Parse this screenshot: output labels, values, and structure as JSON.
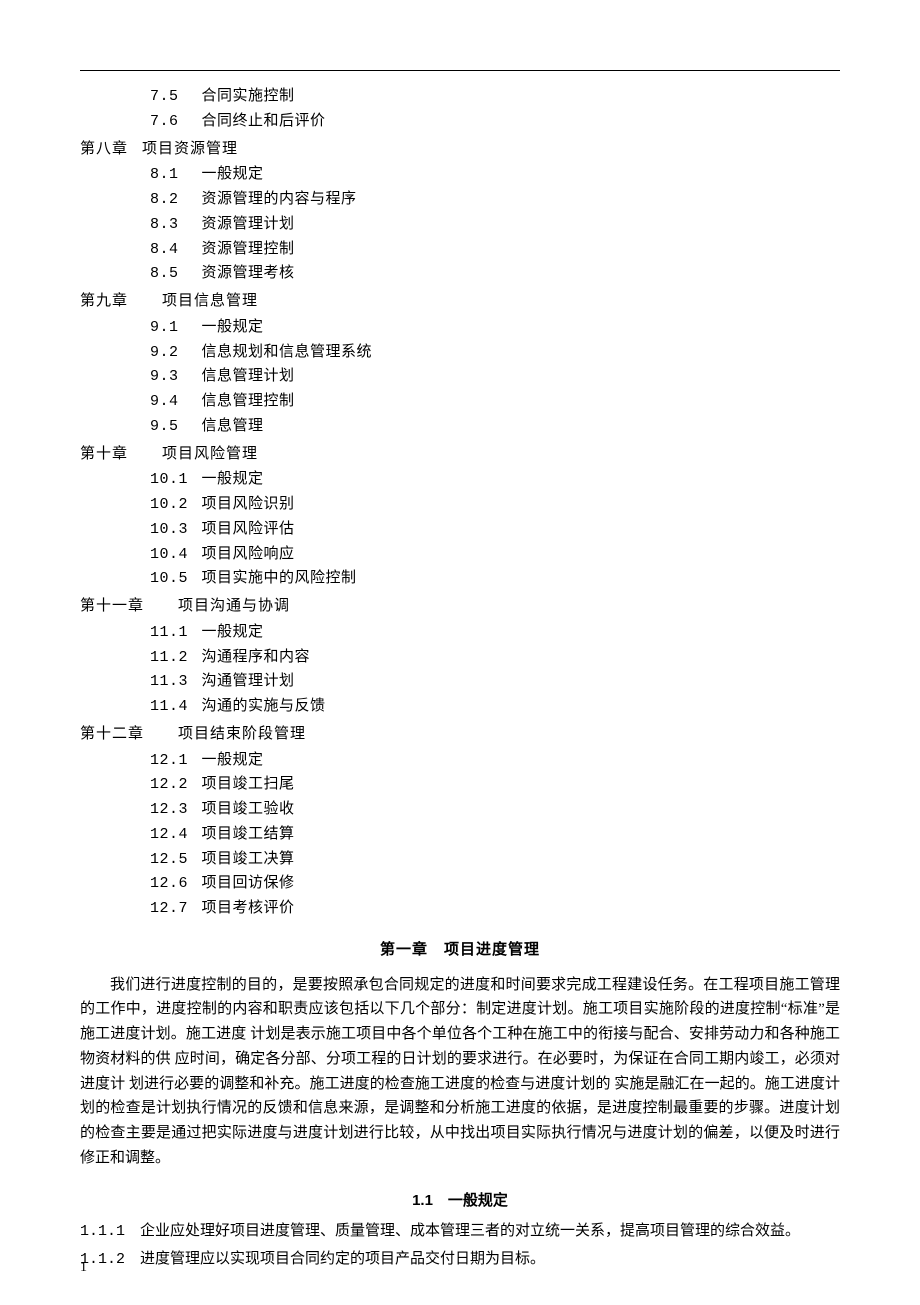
{
  "toc": {
    "pre": [
      {
        "num": "7.5",
        "title": "合同实施控制"
      },
      {
        "num": "7.6",
        "title": "合同终止和后评价"
      }
    ],
    "chapters": [
      {
        "heading": "第八章",
        "title": "项目资源管理",
        "gap": "s",
        "items": [
          {
            "num": "8.1",
            "title": "一般规定"
          },
          {
            "num": "8.2",
            "title": "资源管理的内容与程序"
          },
          {
            "num": "8.3",
            "title": "资源管理计划"
          },
          {
            "num": "8.4",
            "title": "资源管理控制"
          },
          {
            "num": "8.5",
            "title": "资源管理考核"
          }
        ]
      },
      {
        "heading": "第九章",
        "title": "项目信息管理",
        "gap": "m",
        "items": [
          {
            "num": "9.1",
            "title": "一般规定"
          },
          {
            "num": "9.2",
            "title": "信息规划和信息管理系统"
          },
          {
            "num": "9.3",
            "title": "信息管理计划"
          },
          {
            "num": "9.4",
            "title": "信息管理控制"
          },
          {
            "num": "9.5",
            "title": "信息管理"
          }
        ]
      },
      {
        "heading": "第十章",
        "title": "项目风险管理",
        "gap": "m",
        "items": [
          {
            "num": "10.1",
            "title": "一般规定"
          },
          {
            "num": "10.2",
            "title": "项目风险识别"
          },
          {
            "num": "10.3",
            "title": "项目风险评估"
          },
          {
            "num": "10.4",
            "title": "项目风险响应"
          },
          {
            "num": "10.5",
            "title": "项目实施中的风险控制"
          }
        ]
      },
      {
        "heading": "第十一章",
        "title": "项目沟通与协调",
        "gap": "m",
        "items": [
          {
            "num": "11.1",
            "title": "一般规定"
          },
          {
            "num": "11.2",
            "title": "沟通程序和内容"
          },
          {
            "num": "11.3",
            "title": "沟通管理计划"
          },
          {
            "num": "11.4",
            "title": "沟通的实施与反馈"
          }
        ]
      },
      {
        "heading": "第十二章",
        "title": "项目结束阶段管理",
        "gap": "m",
        "items": [
          {
            "num": "12.1",
            "title": "一般规定"
          },
          {
            "num": "12.2",
            "title": "项目竣工扫尾"
          },
          {
            "num": "12.3",
            "title": "项目竣工验收"
          },
          {
            "num": "12.4",
            "title": "项目竣工结算"
          },
          {
            "num": "12.5",
            "title": "项目竣工决算"
          },
          {
            "num": "12.6",
            "title": "项目回访保修"
          },
          {
            "num": "12.7",
            "title": "项目考核评价"
          }
        ]
      }
    ]
  },
  "chapter1": {
    "title": "第一章　项目进度管理",
    "intro": "我们进行进度控制的目的，是要按照承包合同规定的进度和时间要求完成工程建设任务。在工程项目施工管理的工作中，进度控制的内容和职责应该包括以下几个部分：制定进度计划。施工项目实施阶段的进度控制“标准”是施工进度计划。施工进度 计划是表示施工项目中各个单位各个工种在施工中的衔接与配合、安排劳动力和各种施工物资材料的供 应时间，确定各分部、分项工程的日计划的要求进行。在必要时，为保证在合同工期内竣工，必须对进度计 划进行必要的调整和补充。施工进度的检查施工进度的检查与进度计划的 实施是融汇在一起的。施工进度计划的检查是计划执行情况的反馈和信息来源，是调整和分析施工进度的依据，是进度控制最重要的步骤。进度计划的检查主要是通过把实际进度与进度计划进行比较，从中找出项目实际执行情况与进度计划的偏差，以便及时进行修正和调整。",
    "section_title": "1.1　一般规定",
    "clauses": [
      {
        "num": "1.1.1",
        "text": "企业应处理好项目进度管理、质量管理、成本管理三者的对立统一关系，提高项目管理的综合效益。"
      },
      {
        "num": "1.1.2",
        "text": "进度管理应以实现项目合同约定的项目产品交付日期为目标。"
      }
    ]
  },
  "page_number": "1"
}
